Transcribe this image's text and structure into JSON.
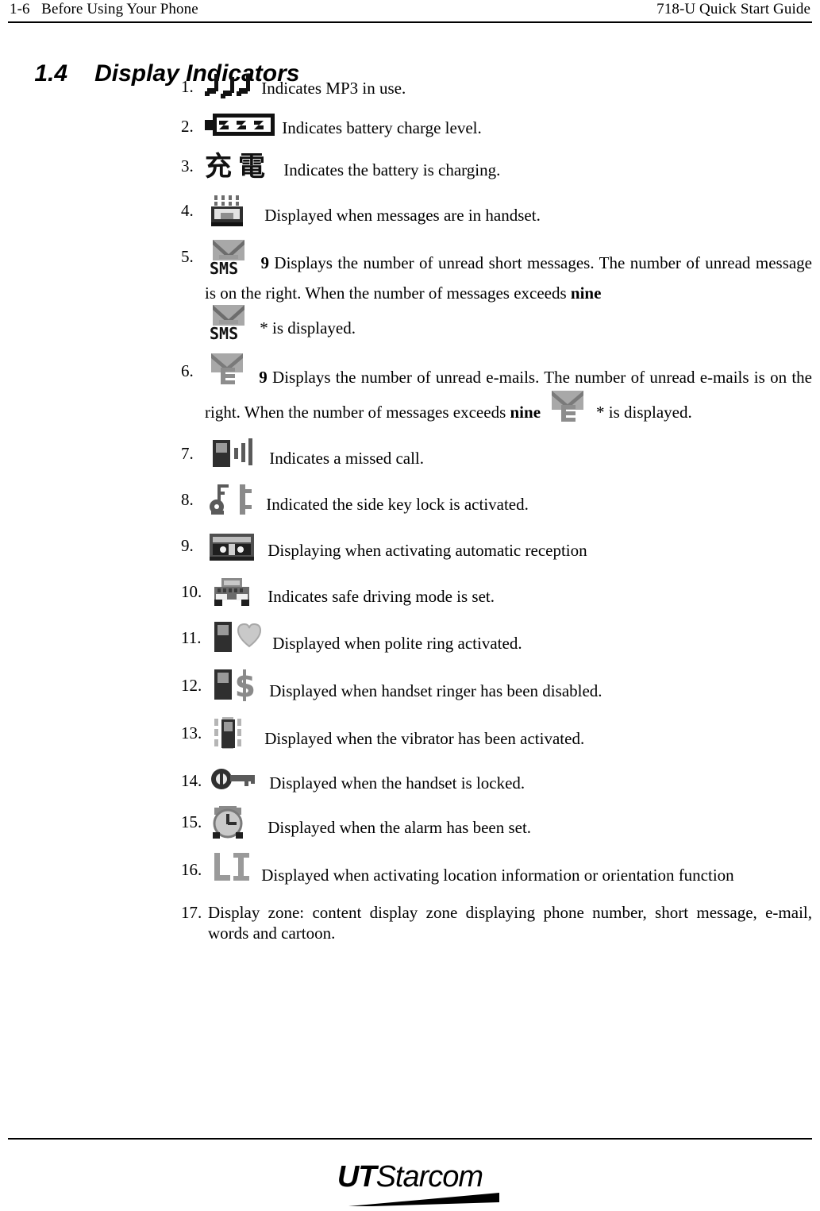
{
  "header": {
    "left": "1-6   Before Using Your Phone",
    "right": "718-U Quick Start Guide"
  },
  "section": {
    "number": "1.4",
    "title": "Display Indicators"
  },
  "items": [
    {
      "number": "1.",
      "icon": "mp3-notes-icon",
      "text": "Indicates MP3 in use."
    },
    {
      "number": "2.",
      "icon": "battery-level-icon",
      "text": "Indicates battery charge level."
    },
    {
      "number": "3.",
      "icon": "battery-charging-icon",
      "text": "Indicates the battery is charging."
    },
    {
      "number": "4.",
      "icon": "message-in-handset-icon",
      "text": "Displayed when messages are in handset."
    },
    {
      "number": "5.",
      "icon": "sms-unread-icon",
      "count": "9",
      "text_a": "Displays the number of unread short messages. The number of unread message is on the right.  When the number of messages exceeds ",
      "bold_word": "nine",
      "icon_b": "sms-overflow-icon",
      "text_b": "* is displayed."
    },
    {
      "number": "6.",
      "icon": "email-unread-icon",
      "count": "9",
      "text_a": "Displays the number of unread e-mails. The number of unread e-mails is on the right. When the number of messages exceeds ",
      "bold_word": "nine",
      "icon_b": "email-overflow-icon",
      "text_b": "* is displayed."
    },
    {
      "number": "7.",
      "icon": "missed-call-icon",
      "text": "Indicates a missed call."
    },
    {
      "number": "8.",
      "icon": "side-key-lock-icon",
      "text": "Indicated the side key lock is activated."
    },
    {
      "number": "9.",
      "icon": "auto-reception-icon",
      "text": "Displaying when activating automatic reception"
    },
    {
      "number": "10.",
      "icon": "safe-driving-icon",
      "text": "Indicates safe driving mode is set."
    },
    {
      "number": "11.",
      "icon": "polite-ring-icon",
      "text": "Displayed when polite ring activated."
    },
    {
      "number": "12.",
      "icon": "ringer-disabled-icon",
      "text": "Displayed when handset ringer has been disabled."
    },
    {
      "number": "13.",
      "icon": "vibrator-icon",
      "text": "Displayed when the vibrator has been activated."
    },
    {
      "number": "14.",
      "icon": "handset-locked-icon",
      "text": "Displayed when the handset is locked."
    },
    {
      "number": "15.",
      "icon": "alarm-set-icon",
      "text": "Displayed when the alarm has been set."
    },
    {
      "number": "16.",
      "icon": "location-info-icon",
      "text": "Displayed when activating location information or orientation function"
    },
    {
      "number": "17.",
      "icon": null,
      "text": "Display zone: content display zone displaying phone number, short message, e-mail, words and cartoon."
    }
  ],
  "footer": {
    "logo_ut": "UT",
    "logo_starcom": "Starcom"
  },
  "colors": {
    "ink": "#000000",
    "paper": "#ffffff",
    "icon_gray": "#9a9a9a",
    "icon_dark": "#3a3a3a"
  }
}
